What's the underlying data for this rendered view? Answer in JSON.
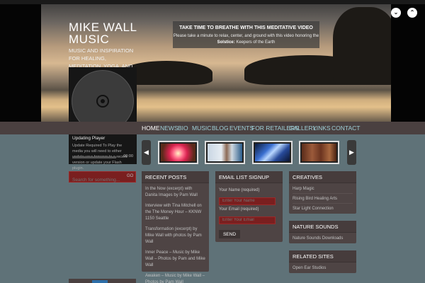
{
  "site": {
    "title": "MIKE WALL MUSIC",
    "tagline": "MUSIC AND INSPIRATION FOR HEALING, MEDITATION, YOGA, AND MASSAGE"
  },
  "notice": {
    "title": "TAKE TIME TO BREATHE WITH THIS MEDITATIVE VIDEO",
    "body_prefix": "Please take a minute to relax, center, and ground with this video honoring the",
    "body_bold": "Solstice:",
    "body_suffix": "Keepers of the Earth"
  },
  "hero_controls": {
    "left": "⌄",
    "right": "⌃"
  },
  "player": {
    "status": "Updating Player",
    "message": "Update Required To Play the media you will need to either update your browser to a recent version or update your Flash plugin.",
    "time": "00:00"
  },
  "nav": [
    "HOME",
    "NEWS",
    "BIO",
    "MUSIC",
    "BLOG",
    "EVENTS",
    "FOR RETAILERS",
    "GALLERY",
    "LINKS",
    "CONTACT"
  ],
  "carousel": {
    "prev": "◀",
    "next": "▶"
  },
  "search": {
    "placeholder": "Search for something...",
    "button": "GO"
  },
  "recent_posts": {
    "heading": "RECENT POSTS",
    "items": [
      "In the Now (excerpt) with Danita Images by Pam Wall",
      "Interview with Tina Mitchell on the The Money Hour – KKNW 1150 Seattle",
      "Transformation (excerpt) by Mike Wall with photos by Pam Wall",
      "Inner Peace – Music by Mike Wall – Photos by Pam and Mike Wall",
      "Awaken – Music by Mike Wall – Photos by Pam Wall"
    ]
  },
  "email_signup": {
    "heading": "EMAIL LIST SIGNUP",
    "name_label": "Your Name (required)",
    "name_placeholder": "Enter Your Name",
    "email_label": "Your Email (required)",
    "email_placeholder": "Enter Your Email",
    "send": "SEND"
  },
  "creatives": {
    "heading": "CREATIVES",
    "items": [
      "Harp Magic",
      "Rising Bird Healing Arts",
      "Star Light Connection"
    ]
  },
  "nature_sounds": {
    "heading": "NATURE SOUNDS",
    "items": [
      "Nature Sounds Downloads"
    ]
  },
  "related_sites": {
    "heading": "RELATED SITES",
    "items": [
      "Open Ear Studios"
    ]
  },
  "colors": {
    "background": "#5f7278",
    "nav_text": "#9fd0d8",
    "input_red": "#7a1f1f",
    "panel": "#4e4444"
  }
}
